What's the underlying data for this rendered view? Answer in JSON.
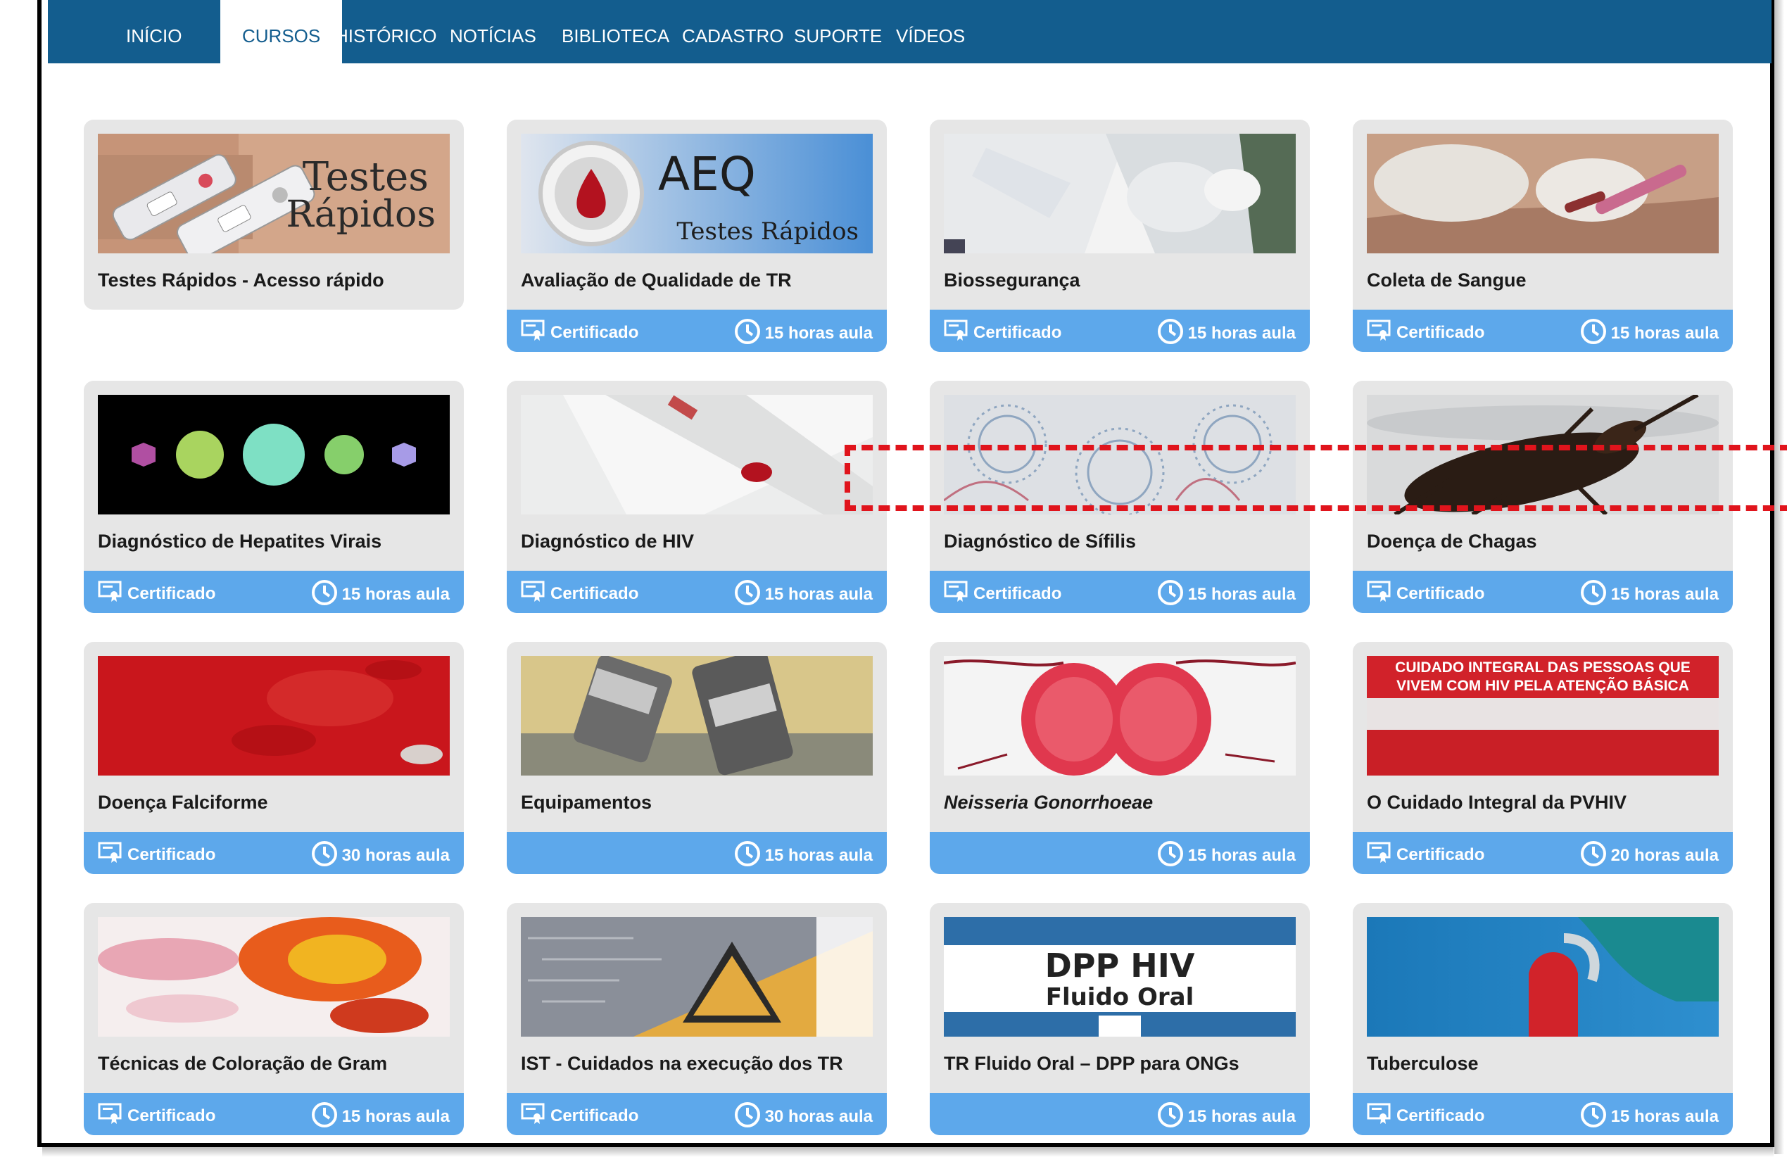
{
  "nav": {
    "tabs": [
      {
        "label": "INÍCIO"
      },
      {
        "label": "CURSOS"
      },
      {
        "label": "HISTÓRICO"
      },
      {
        "label": "NOTÍCIAS"
      },
      {
        "label": "BIBLIOTECA"
      },
      {
        "label": "CADASTRO"
      },
      {
        "label": "SUPORTE"
      },
      {
        "label": "VÍDEOS"
      }
    ],
    "active_tab": "CURSOS"
  },
  "courses": [
    {
      "title": "Testes Rápidos - Acesso rápido",
      "image_text": [
        "Testes",
        "Rápidos"
      ]
    },
    {
      "title": "Avaliação de Qualidade de TR",
      "image_text": [
        "AEQ",
        "Testes Rápidos"
      ],
      "cert": "Certificado",
      "hours": "15 horas aula"
    },
    {
      "title": "Biossegurança",
      "cert": "Certificado",
      "hours": "15 horas aula"
    },
    {
      "title": "Coleta de Sangue",
      "cert": "Certificado",
      "hours": "15 horas aula"
    },
    {
      "title": "Diagnóstico de Hepatites Virais",
      "cert": "Certificado",
      "hours": "15 horas aula"
    },
    {
      "title": "Diagnóstico de HIV",
      "cert": "Certificado",
      "hours": "15 horas aula"
    },
    {
      "title": "Diagnóstico de Sífilis",
      "cert": "Certificado",
      "hours": "15 horas aula"
    },
    {
      "title": "Doença de Chagas",
      "cert": "Certificado",
      "hours": "15 horas aula"
    },
    {
      "title": "Doença Falciforme",
      "cert": "Certificado",
      "hours": "30 horas aula"
    },
    {
      "title": "Equipamentos",
      "hours": "15 horas aula"
    },
    {
      "title": "Neisseria Gonorrhoeae",
      "hours": "15 horas aula"
    },
    {
      "title": "O Cuidado Integral da PVHIV",
      "image_text": [
        "CUIDADO INTEGRAL DAS PESSOAS QUE",
        "VIVEM COM HIV PELA ATENÇÃO BÁSICA"
      ],
      "cert": "Certificado",
      "hours": "20 horas aula"
    },
    {
      "title": "Técnicas de Coloração de Gram",
      "cert": "Certificado",
      "hours": "15 horas aula"
    },
    {
      "title": "IST - Cuidados na execução dos TR",
      "cert": "Certificado",
      "hours": "30 horas aula"
    },
    {
      "title": "TR Fluido Oral – DPP para ONGs",
      "image_text": [
        "DPP HIV",
        "Fluido Oral"
      ],
      "hours": "15 horas aula"
    },
    {
      "title": "Tuberculose",
      "cert": "Certificado",
      "hours": "15 horas aula"
    }
  ],
  "colors": {
    "nav_bg": "#135d8e",
    "bar_bg": "#5da8eb",
    "card_bg": "#e6e6e6",
    "highlight": "#e0141c"
  },
  "icons": {
    "cert": "certificate-icon",
    "hours": "clock-icon"
  }
}
